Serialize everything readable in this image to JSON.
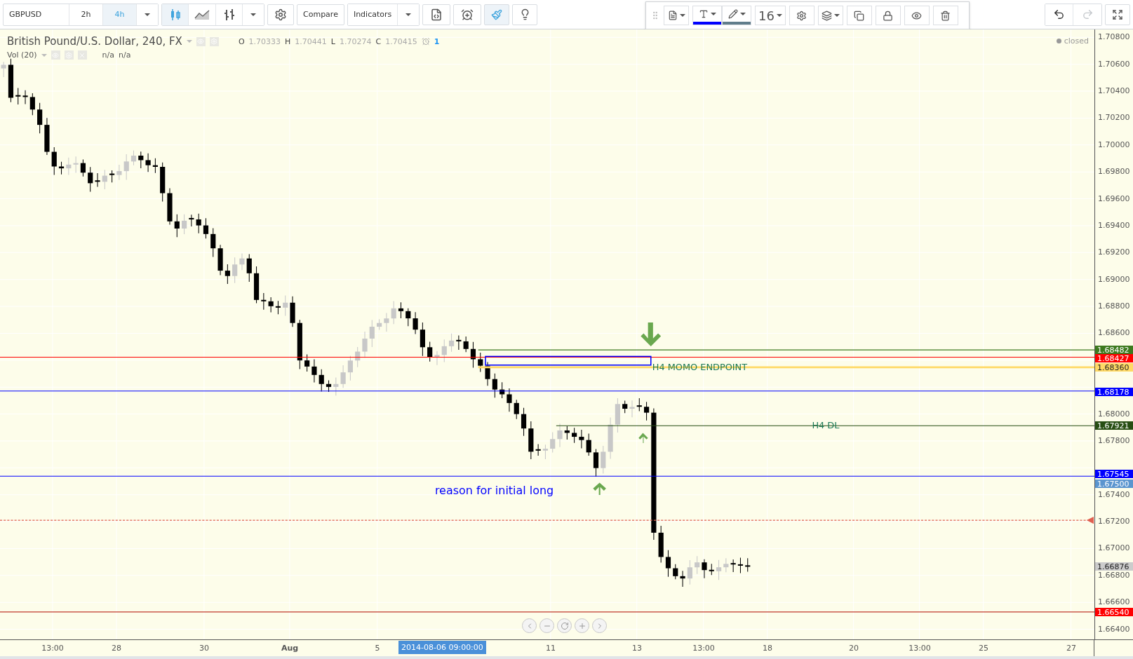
{
  "toolbar": {
    "symbol": "GBPUSD",
    "intervals": [
      {
        "label": "2h",
        "selected": false
      },
      {
        "label": "4h",
        "selected": true
      }
    ],
    "chart_styles": [
      {
        "kind": "candles",
        "selected": true
      },
      {
        "kind": "area",
        "selected": false
      },
      {
        "kind": "bars",
        "selected": false
      }
    ],
    "buttons": [
      "Compare",
      "Indicators"
    ],
    "brush_selected": true
  },
  "drawing_toolbar": {
    "swatches": [
      {
        "kind": "text",
        "color": "#0000ff"
      },
      {
        "kind": "line",
        "color": "#607d8b"
      }
    ],
    "font_size": "16"
  },
  "history": [
    {
      "kind": "undo",
      "disabled": false
    },
    {
      "kind": "redo",
      "disabled": true
    }
  ],
  "legend": {
    "title": "British Pound/U.S. Dollar, 240, FX",
    "ohlc": [
      {
        "key": "O",
        "value": "1.70333"
      },
      {
        "key": "H",
        "value": "1.70441"
      },
      {
        "key": "L",
        "value": "1.70274"
      },
      {
        "key": "C",
        "value": "1.70415"
      }
    ],
    "alerts": "1",
    "study": "Vol (20)",
    "study_values": [
      "n/a",
      "n/a"
    ]
  },
  "market_status": "closed",
  "annotations": [
    "H4 MOMO ENDPOINT",
    "H4 DL",
    "reason for initial long"
  ],
  "price_axis": {
    "ticks": [
      "1.70800",
      "1.70600",
      "1.70400",
      "1.70200",
      "1.70000",
      "1.69800",
      "1.69600",
      "1.69400",
      "1.69200",
      "1.69000",
      "1.68800",
      "1.68600",
      "1.68000",
      "1.67800",
      "1.67400",
      "1.67200",
      "1.67000",
      "1.66800",
      "1.66600",
      "1.66400"
    ],
    "tags": [
      {
        "label": "1.68482",
        "color": "#3d7a1e"
      },
      {
        "label": "1.68427",
        "color": "#ff0000"
      },
      {
        "label": "1.68360",
        "color": "#ffd966"
      },
      {
        "label": "1.68178",
        "color": "#0000ff"
      },
      {
        "label": "1.67921",
        "color": "#274e13"
      },
      {
        "label": "1.67545",
        "color": "#0000ff"
      },
      {
        "label": "1.67500",
        "color": "#5b95cf"
      },
      {
        "label": "1.66876",
        "color": "#cccccc"
      },
      {
        "label": "1.66540",
        "color": "#ff0000"
      }
    ]
  },
  "time_axis": {
    "labels": [
      {
        "label": "13:00",
        "bold": false
      },
      {
        "label": "28",
        "bold": false
      },
      {
        "label": "30",
        "bold": false
      },
      {
        "label": "Aug",
        "bold": true
      },
      {
        "label": "5",
        "bold": false
      },
      {
        "label": "11",
        "bold": false
      },
      {
        "label": "13",
        "bold": false
      },
      {
        "label": "13:00",
        "bold": false
      },
      {
        "label": "18",
        "bold": false
      },
      {
        "label": "20",
        "bold": false
      },
      {
        "label": "13:00",
        "bold": false
      },
      {
        "label": "25",
        "bold": false
      },
      {
        "label": "27",
        "bold": false
      }
    ],
    "cursor_label": "2014-08-06 09:00:00"
  }
}
